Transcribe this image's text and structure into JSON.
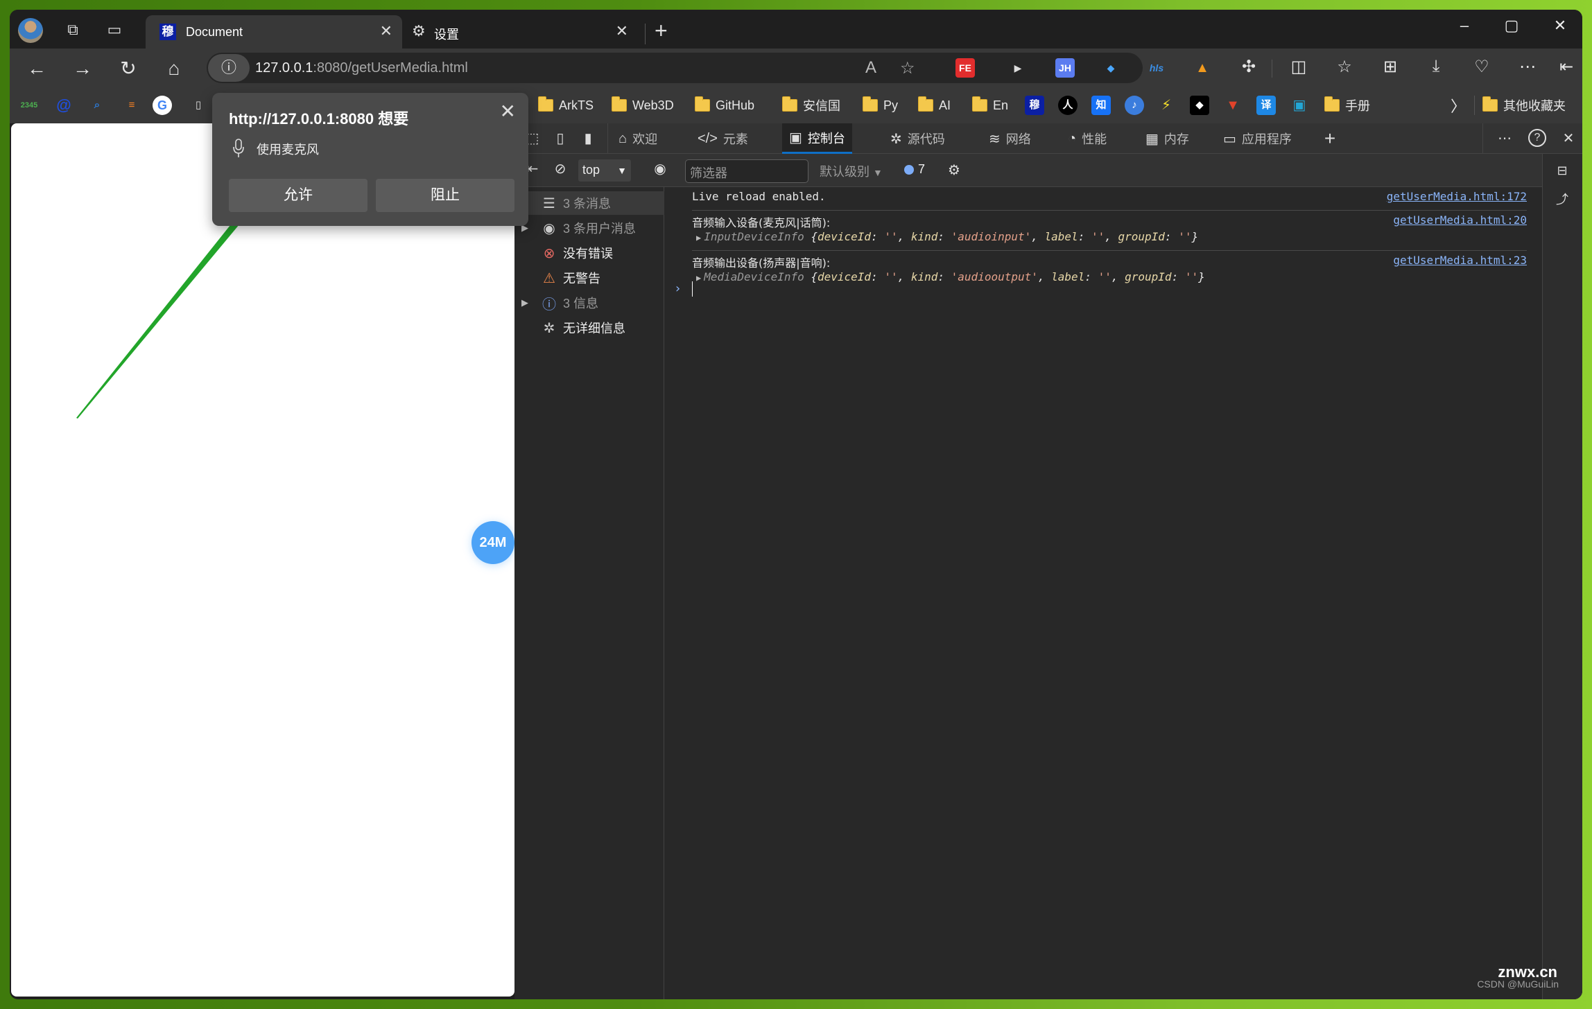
{
  "window": {
    "tabs": [
      {
        "title": "Document",
        "favicon_text": "穆",
        "active": true
      },
      {
        "title": "设置",
        "active": false
      }
    ],
    "controls": {
      "minimize": "–",
      "maximize": "▢",
      "close": "✕"
    }
  },
  "address_bar": {
    "host": "127.0.0.1",
    "path": ":8080/getUserMedia.html"
  },
  "extensions": [
    {
      "name": "fe-helper",
      "label": "FE",
      "color": "#e22d2d"
    },
    {
      "name": "media-control",
      "label": "▶",
      "color": "#222222"
    },
    {
      "name": "jh",
      "label": "JH",
      "color": "#5b7cf0"
    },
    {
      "name": "pin",
      "label": "📍",
      "color": "#1e90ff"
    },
    {
      "name": "hls",
      "label": "hls",
      "color": "#3b6fd6"
    },
    {
      "name": "helmet",
      "label": "⛑",
      "color": "#f29a1d"
    }
  ],
  "bookmarks": {
    "icons_left": [
      "2345",
      "@",
      "Q",
      "stack",
      "G",
      "page"
    ],
    "items": [
      {
        "type": "folder",
        "label": "ArkTS"
      },
      {
        "type": "folder",
        "label": "Web3D"
      },
      {
        "type": "folder",
        "label": "GitHub"
      },
      {
        "type": "folder",
        "label": "安信国"
      },
      {
        "type": "folder",
        "label": "Py"
      },
      {
        "type": "folder",
        "label": "AI"
      },
      {
        "type": "folder",
        "label": "En"
      },
      {
        "type": "icon",
        "label": "穆"
      },
      {
        "type": "icon",
        "label": "人"
      },
      {
        "type": "icon",
        "label": "知"
      },
      {
        "type": "icon",
        "label": "♪"
      },
      {
        "type": "icon",
        "label": "⚡"
      },
      {
        "type": "icon",
        "label": "◆"
      },
      {
        "type": "icon",
        "label": "🦊"
      },
      {
        "type": "icon",
        "label": "译"
      },
      {
        "type": "icon",
        "label": "📺"
      },
      {
        "type": "folder",
        "label": "手册"
      }
    ],
    "overflow": "〉",
    "other": "其他收藏夹"
  },
  "permission_popup": {
    "title": "http://127.0.0.1:8080 想要",
    "request": "使用麦克风",
    "allow": "允许",
    "block": "阻止",
    "close": "✕"
  },
  "page": {
    "memory_badge": "24M",
    "arrow_color": "#22a52a"
  },
  "devtools": {
    "tabs": [
      {
        "name": "welcome",
        "label": "欢迎",
        "icon": "⌂"
      },
      {
        "name": "elements",
        "label": "元素",
        "icon": "</>"
      },
      {
        "name": "console",
        "label": "控制台",
        "icon": "▣",
        "active": true
      },
      {
        "name": "sources",
        "label": "源代码",
        "icon": "✲"
      },
      {
        "name": "network",
        "label": "网络",
        "icon": "≋"
      },
      {
        "name": "performance",
        "label": "性能",
        "icon": "◔"
      },
      {
        "name": "memory",
        "label": "内存",
        "icon": "▦"
      },
      {
        "name": "application",
        "label": "应用程序",
        "icon": "▭"
      }
    ],
    "add_tab": "+",
    "more": "⋯",
    "help": "?",
    "close": "✕",
    "console_toolbar": {
      "context": "top",
      "filter_placeholder": "筛选器",
      "level": "默认级别",
      "message_count": "7"
    },
    "sidebar": [
      {
        "name": "messages",
        "label": "3 条消息",
        "icon": "☰",
        "expandable": true,
        "dim": true,
        "selected": true,
        "icon_color": "#cccccc"
      },
      {
        "name": "user-messages",
        "label": "3 条用户消息",
        "icon": "◉",
        "expandable": true,
        "dim": true,
        "icon_color": "#cccccc"
      },
      {
        "name": "errors",
        "label": "没有错误",
        "icon": "⊗",
        "expandable": false,
        "dim": false,
        "icon_color": "#e46962"
      },
      {
        "name": "warnings",
        "label": "无警告",
        "icon": "⚠",
        "expandable": false,
        "dim": false,
        "icon_color": "#e8844a"
      },
      {
        "name": "info",
        "label": "3 信息",
        "icon": "ⓘ",
        "expandable": true,
        "dim": true,
        "icon_color": "#7ca3f0"
      },
      {
        "name": "verbose",
        "label": "无详细信息",
        "icon": "✲",
        "expandable": false,
        "dim": false,
        "icon_color": "#cccccc"
      }
    ],
    "console_rows": [
      {
        "message": "Live reload enabled.",
        "source": "getUserMedia.html:172"
      },
      {
        "message": "音频输入设备(麦克风|话筒):",
        "source": "getUserMedia.html:20",
        "object": {
          "class": "InputDeviceInfo",
          "deviceId": "''",
          "kind": "'audioinput'",
          "label": "''",
          "groupId": "''"
        }
      },
      {
        "message": "音频输出设备(扬声器|音响):",
        "source": "getUserMedia.html:23",
        "object": {
          "class": "MediaDeviceInfo",
          "deviceId": "''",
          "kind": "'audiooutput'",
          "label": "''",
          "groupId": "''"
        }
      }
    ],
    "prompt": "›"
  },
  "watermark": {
    "site": "znwx.cn",
    "author": "CSDN @MuGuiLin"
  }
}
